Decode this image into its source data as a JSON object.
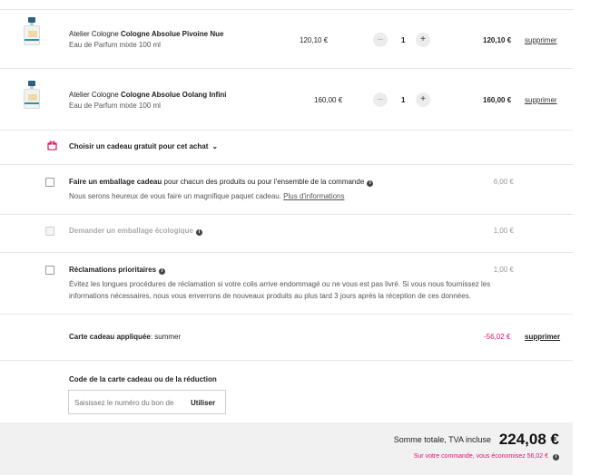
{
  "cart": {
    "items": [
      {
        "brand": "Atelier Cologne",
        "name": "Cologne Absolue Pivoine Nue",
        "subtitle": "Eau de Parfum mixte 100 ml",
        "unit_price": "120,10 €",
        "qty_minus": "–",
        "qty_plus": "+",
        "quantity": "1",
        "total": "120,10 €",
        "remove": "supprimer"
      },
      {
        "brand": "Atelier Cologne",
        "name": "Cologne Absolue Oolang Infini",
        "subtitle": "Eau de Parfum mixte 100 ml",
        "unit_price": "160,00 €",
        "qty_minus": "–",
        "qty_plus": "+",
        "quantity": "1",
        "total": "160,00 €",
        "remove": "supprimer"
      }
    ]
  },
  "gift": {
    "label": "Choisir un cadeau gratuit pour cet achat",
    "chevron": "⌄"
  },
  "options": {
    "wrapping": {
      "title": "Faire un emballage cadeau",
      "title_rest": "pour chacun des produits ou pour l'ensemble de la commande",
      "desc": "Nous serons heureux de vous faire un magnifique paquet cadeau.",
      "link": "Plus d'informations",
      "price": "6,00 €"
    },
    "eco": {
      "title": "Demander un emballage écologique",
      "price": "1,00 €"
    },
    "priority": {
      "title": "Réclamations prioritaires",
      "desc_line1": "Évitez les longues procédures de réclamation si votre colis arrive endommagé ou ne vous est pas livré. Si vous nous fournissez les",
      "desc_line2": "informations nécessaires, nous vous enverrons de nouveaux produits au plus tard 3 jours après la réception de ces données.",
      "price": "1,00 €"
    }
  },
  "giftcard": {
    "label": "Carte cadeau appliquée",
    "code": ": summer",
    "amount": "-56,02 €",
    "remove": "supprimer"
  },
  "voucher": {
    "label": "Code de la carte cadeau ou de la réduction",
    "placeholder": "Saisissez le numéro du bon de",
    "apply": "Utiliser"
  },
  "summary": {
    "label": "Somme totale, TVA incluse",
    "total": "224,08 €",
    "savings": "Sur votre commande, vous économisez 56,02 €"
  },
  "colors": {
    "accent": "#e0156b",
    "footer_bg": "#f1f1f1"
  }
}
